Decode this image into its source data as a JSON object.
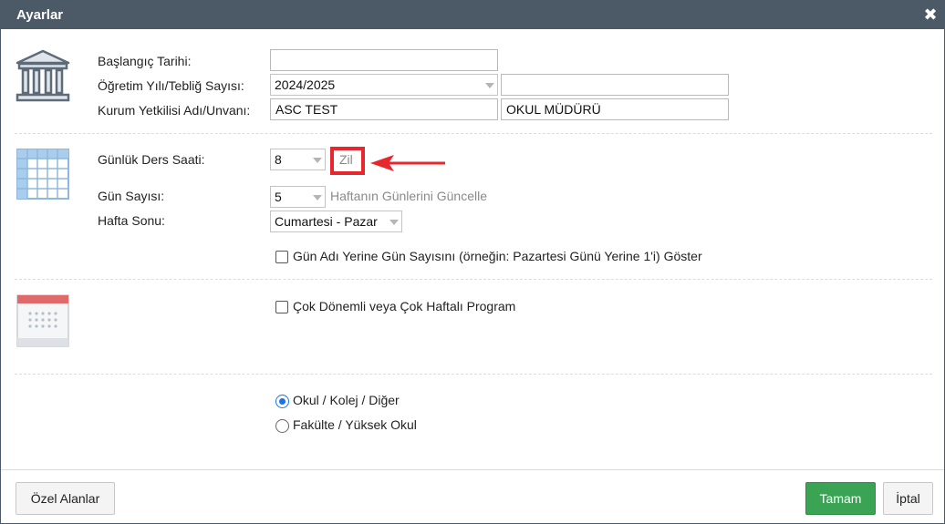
{
  "window": {
    "title": "Ayarlar",
    "close_symbol": "✖"
  },
  "section1": {
    "icon": "institution-building-icon",
    "start_date_label": "Başlangıç Tarihi:",
    "start_date_value": "",
    "year_label": "Öğretim Yılı/Tebliğ Sayısı:",
    "year_value": "2024/2025",
    "circular_value": "",
    "official_label": "Kurum Yetkilisi Adı/Unvanı:",
    "official_name": "ASC TEST",
    "official_title": "OKUL MÜDÜRÜ"
  },
  "section2": {
    "icon": "timetable-grid-icon",
    "daily_hours_label": "Günlük Ders Saati:",
    "daily_hours_value": "8",
    "bell_link": "Zil",
    "day_count_label": "Gün Sayısı:",
    "day_count_value": "5",
    "update_days_link": "Haftanın Günlerini Güncelle",
    "weekend_label": "Hafta Sonu:",
    "weekend_value": "Cumartesi - Pazar",
    "show_day_number_label": "Gün Adı Yerine Gün Sayısını (örneğin: Pazartesi Günü Yerine 1'i) Göster",
    "show_day_number_checked": false
  },
  "section3": {
    "icon": "calendar-icon",
    "multi_period_label": "Çok Dönemli veya Çok Haftalı Program",
    "multi_period_checked": false
  },
  "section4": {
    "school_type_options": [
      "Okul / Kolej / Diğer",
      "Fakülte / Yüksek Okul"
    ],
    "school_type_selected": "Okul / Kolej / Diğer"
  },
  "footer": {
    "custom_fields_label": "Özel Alanlar",
    "ok_label": "Tamam",
    "cancel_label": "İptal"
  },
  "colors": {
    "titlebar": "#4b5a66",
    "primary_button": "#3aa354",
    "annotation_red": "#e8262d",
    "radio_blue": "#1a73e8"
  }
}
